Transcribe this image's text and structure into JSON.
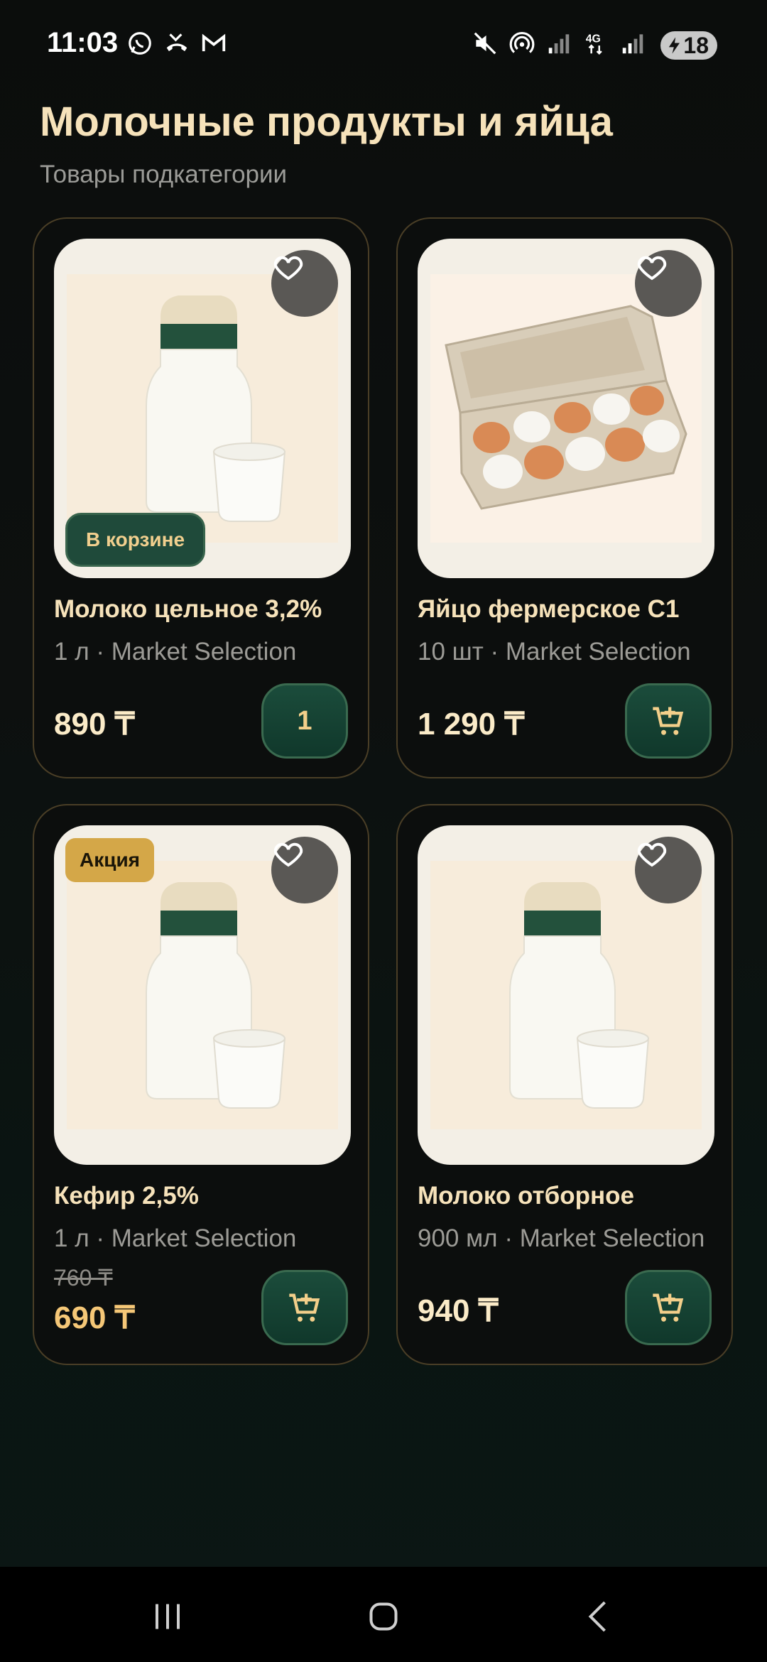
{
  "status_bar": {
    "time": "11:03",
    "left_icons": [
      "whatsapp-icon",
      "missed-call-icon",
      "gmail-icon"
    ],
    "right_icons": [
      "mute-icon",
      "hotspot-icon",
      "signal-icon",
      "4g-icon",
      "signal-icon"
    ],
    "battery": "18"
  },
  "header": {
    "title": "Молочные продукты и яйца",
    "subtitle": "Товары подкатегории"
  },
  "products": [
    {
      "name": "Молоко цельное 3,2%",
      "meta": "1 л · Market Selection",
      "price": "890 ₸",
      "old_price": "",
      "badge_in_cart": "В корзине",
      "badge_sale": "",
      "cart_quantity": "1",
      "image": "milk-bottle-image"
    },
    {
      "name": "Яйцо фермерское С1",
      "meta": "10 шт · Market Selection",
      "price": "1 290 ₸",
      "old_price": "",
      "badge_in_cart": "",
      "badge_sale": "",
      "cart_quantity": "",
      "image": "egg-carton-image"
    },
    {
      "name": "Кефир 2,5%",
      "meta": "1 л · Market Selection",
      "price": "690 ₸",
      "old_price": "760 ₸",
      "badge_in_cart": "",
      "badge_sale": "Акция",
      "cart_quantity": "",
      "image": "milk-bottle-image"
    },
    {
      "name": "Молоко отборное",
      "meta": "900 мл · Market Selection",
      "price": "940 ₸",
      "old_price": "",
      "badge_in_cart": "",
      "badge_sale": "",
      "cart_quantity": "",
      "image": "milk-bottle-image"
    }
  ],
  "colors": {
    "accent_gold": "#f6e2ba",
    "button_green": "#1b4c3b",
    "sale_badge": "#d4a748",
    "sale_price": "#f5c777"
  },
  "nav": [
    "recents-icon",
    "home-icon",
    "back-icon"
  ]
}
